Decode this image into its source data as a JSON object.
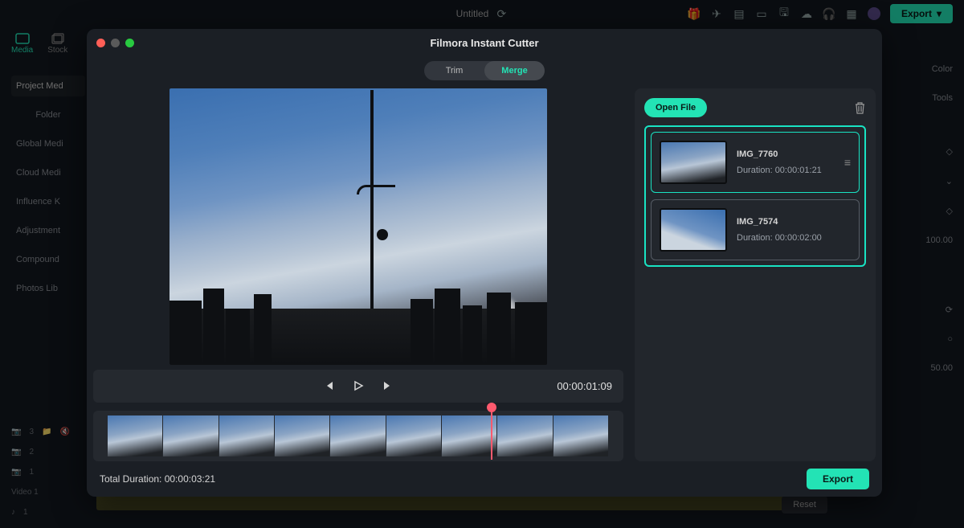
{
  "app": {
    "title": "Untitled",
    "export_label": "Export"
  },
  "media_tabs": {
    "media": "Media",
    "stock": "Stock"
  },
  "sidebar": {
    "items": [
      "Project Med",
      "Folder",
      "Global Medi",
      "Cloud Medi",
      "Influence K",
      "Adjustment",
      "Compound",
      "Photos Lib"
    ]
  },
  "right_side": {
    "color": "Color",
    "tools": "Tools",
    "val1": "100.00",
    "val2": "50.00"
  },
  "tracks": {
    "t1": "3",
    "t2": "2",
    "t3": "1",
    "video": "Video 1",
    "a1": "1"
  },
  "bg": {
    "reset": "Reset"
  },
  "modal": {
    "title": "Filmora Instant Cutter",
    "tab_trim": "Trim",
    "tab_merge": "Merge",
    "timecode": "00:00:01:09",
    "open_file": "Open File",
    "files": [
      {
        "name": "IMG_7760",
        "duration": "Duration: 00:00:01:21"
      },
      {
        "name": "IMG_7574",
        "duration": "Duration: 00:00:02:00"
      }
    ],
    "total_duration": "Total Duration: 00:00:03:21",
    "export": "Export"
  }
}
